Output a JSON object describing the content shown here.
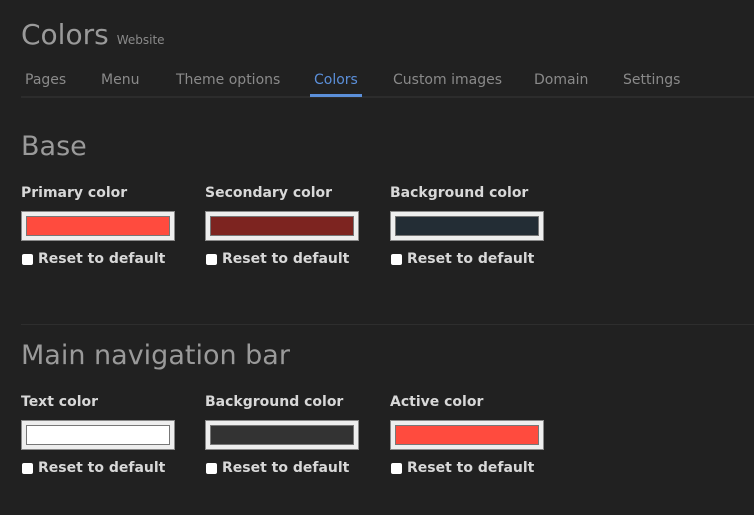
{
  "header": {
    "title": "Colors",
    "subtitle": "Website"
  },
  "tabs": [
    {
      "label": "Pages",
      "active": false
    },
    {
      "label": "Menu",
      "active": false
    },
    {
      "label": "Theme options",
      "active": false
    },
    {
      "label": "Colors",
      "active": true
    },
    {
      "label": "Custom images",
      "active": false
    },
    {
      "label": "Domain",
      "active": false
    },
    {
      "label": "Settings",
      "active": false
    }
  ],
  "accent_color": "#5b8fd9",
  "sections": [
    {
      "title": "Base",
      "fields": [
        {
          "label": "Primary color",
          "color": "#ff4b3e",
          "reset_label": "Reset to default",
          "reset_checked": false
        },
        {
          "label": "Secondary color",
          "color": "#7d2420",
          "reset_label": "Reset to default",
          "reset_checked": false
        },
        {
          "label": "Background color",
          "color": "#232d35",
          "reset_label": "Reset to default",
          "reset_checked": false
        }
      ]
    },
    {
      "title": "Main navigation bar",
      "fields": [
        {
          "label": "Text color",
          "color": "#ffffff",
          "reset_label": "Reset to default",
          "reset_checked": false
        },
        {
          "label": "Background color",
          "color": "#333333",
          "reset_label": "Reset to default",
          "reset_checked": false
        },
        {
          "label": "Active color",
          "color": "#ff4b3e",
          "reset_label": "Reset to default",
          "reset_checked": false
        }
      ]
    }
  ]
}
